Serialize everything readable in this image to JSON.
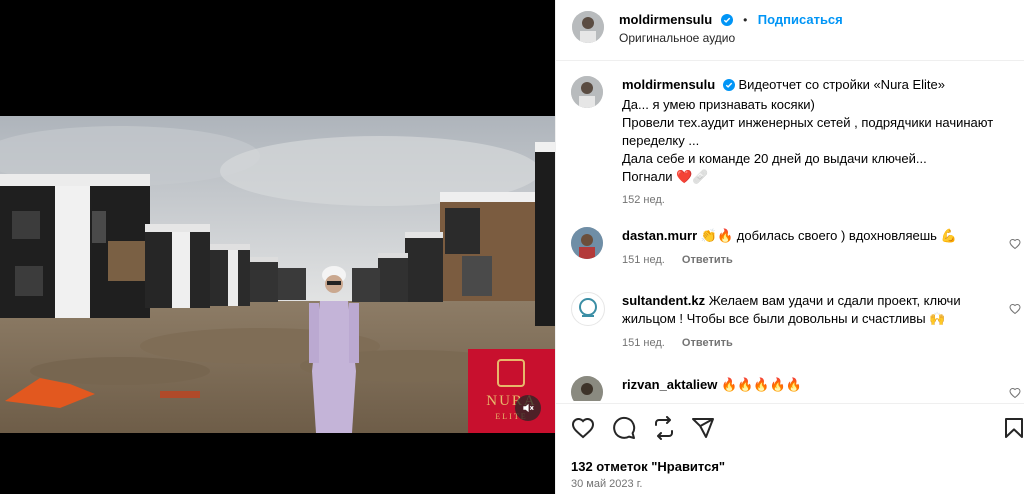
{
  "post": {
    "username": "moldirmensulu",
    "follow_label": "Подписаться",
    "separator": "•",
    "audio": "Оригинальное аудио",
    "caption_lines": [
      "Видеотчет со стройки «Nura Elite»",
      "Да... я умею признавать косяки)",
      "Провели тех.аудит инженерных сетей , подрядчики начинают переделку ...",
      "Дала себе и команде 20 дней до выдачи ключей...",
      "Погнали ❤️🩹"
    ],
    "caption_time": "152 нед.",
    "likes": "132 отметок \"Нравится\"",
    "date": "30 май 2023 г."
  },
  "comments": [
    {
      "username": "dastan.murr",
      "text": "👏🔥 добилась своего ) вдохновляешь 💪",
      "time": "151 нед.",
      "reply": "Ответить"
    },
    {
      "username": "sultandent.kz",
      "text": "Желаем вам удачи и сдали проект, ключи жильцом ! Чтобы все были довольны и счастливы 🙌",
      "time": "151 нед.",
      "reply": "Ответить"
    },
    {
      "username": "rizvan_aktaliew",
      "text": "🔥🔥🔥🔥🔥",
      "time": "",
      "reply": ""
    }
  ],
  "video": {
    "brand_name": "NURA",
    "brand_sub": "ELITE",
    "brand_color": "#c8102e"
  },
  "icons": {
    "like": "heart-icon",
    "comment": "comment-icon",
    "share": "share-icon",
    "repost": "repost-icon",
    "save": "bookmark-icon",
    "mute": "muted-speaker-icon",
    "verified": "verified-badge-icon"
  },
  "colors": {
    "accent": "#0095f6",
    "muted": "#737373",
    "verified": "#0095f6"
  }
}
